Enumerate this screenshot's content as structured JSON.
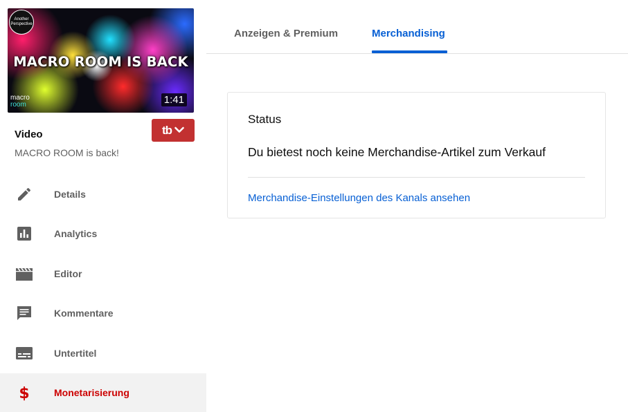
{
  "video": {
    "thumbnail": {
      "channel_logo_line1": "Another",
      "channel_logo_line2": "Perspective",
      "title_overlay": "MACRO ROOM IS BACK",
      "brand_line1": "macro",
      "brand_line2": "room",
      "duration": "1:41"
    },
    "label": "Video",
    "title": "MACRO ROOM is back!"
  },
  "sidebar": {
    "items": [
      {
        "label": "Details",
        "icon": "pencil-icon"
      },
      {
        "label": "Analytics",
        "icon": "bar-chart-icon"
      },
      {
        "label": "Editor",
        "icon": "clapperboard-icon"
      },
      {
        "label": "Kommentare",
        "icon": "comment-icon"
      },
      {
        "label": "Untertitel",
        "icon": "subtitles-icon"
      },
      {
        "label": "Monetarisierung",
        "icon": "dollar-icon",
        "active": true
      }
    ]
  },
  "tabs": [
    {
      "label": "Anzeigen & Premium",
      "active": false
    },
    {
      "label": "Merchandising",
      "active": true
    }
  ],
  "card": {
    "status_label": "Status",
    "status_text": "Du bietest noch keine Merchandise-Artikel zum Verkauf",
    "link": "Merchandise-Einstellungen des Kanals ansehen"
  },
  "colors": {
    "accent_blue": "#065fd4",
    "active_red": "#cc0000",
    "tubebuddy_red": "#c23131"
  }
}
